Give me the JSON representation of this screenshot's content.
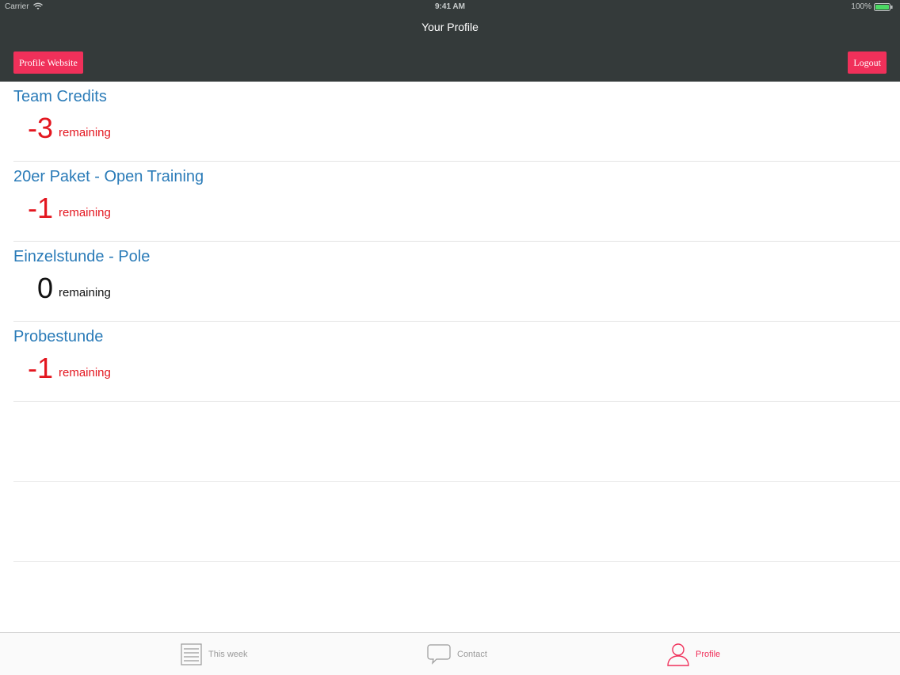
{
  "status_bar": {
    "carrier": "Carrier",
    "time": "9:41 AM",
    "battery": "100%"
  },
  "nav": {
    "title": "Your Profile",
    "left_button": "Profile Website",
    "right_button": "Logout"
  },
  "credits": [
    {
      "title": "Team Credits",
      "count": "-3",
      "remaining_label": "remaining",
      "status": "negative"
    },
    {
      "title": "20er Paket - Open Training",
      "count": "-1",
      "remaining_label": "remaining",
      "status": "negative"
    },
    {
      "title": "Einzelstunde - Pole",
      "count": "0",
      "remaining_label": "remaining",
      "status": "zero"
    },
    {
      "title": "Probestunde",
      "count": "-1",
      "remaining_label": "remaining",
      "status": "negative"
    }
  ],
  "tabs": [
    {
      "label": "This week",
      "icon": "list-icon",
      "active": false
    },
    {
      "label": "Contact",
      "icon": "chat-bubble-icon",
      "active": false
    },
    {
      "label": "Profile",
      "icon": "person-icon",
      "active": true
    }
  ],
  "colors": {
    "header_bg": "#343a3a",
    "accent": "#f0305a",
    "title_blue": "#2a7bb8",
    "negative_red": "#e3161f"
  }
}
